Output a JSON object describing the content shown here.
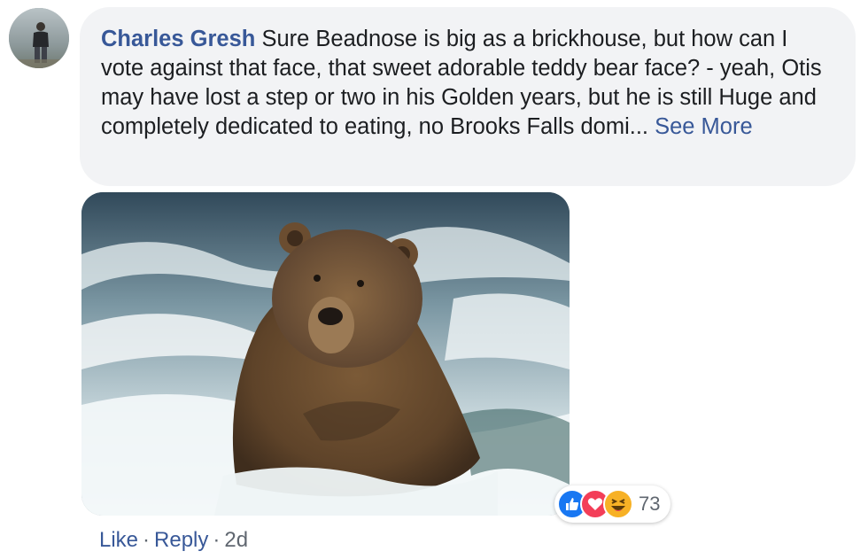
{
  "comment": {
    "author": "Charles Gresh",
    "text": "Sure Beadnose is big as a brickhouse, but how can I vote against that face, that sweet adorable teddy bear face? - yeah, Otis may have lost a step or two in his Golden years, but he is still Huge and completely dedicated to eating, no Brooks Falls domi...",
    "see_more": "See More"
  },
  "attachment": {
    "icon": "brown-bear-photo"
  },
  "reactions": {
    "types": [
      "like-icon",
      "love-icon",
      "haha-icon"
    ],
    "count": "73",
    "colors": {
      "like": "#1877f2",
      "love": "#f33e58",
      "haha": "#f7b125"
    }
  },
  "actions": {
    "like": "Like",
    "reply": "Reply",
    "separator": "·",
    "timestamp": "2d"
  },
  "colors": {
    "link": "#385898",
    "bubble": "#f2f3f5",
    "meta": "#606770"
  }
}
